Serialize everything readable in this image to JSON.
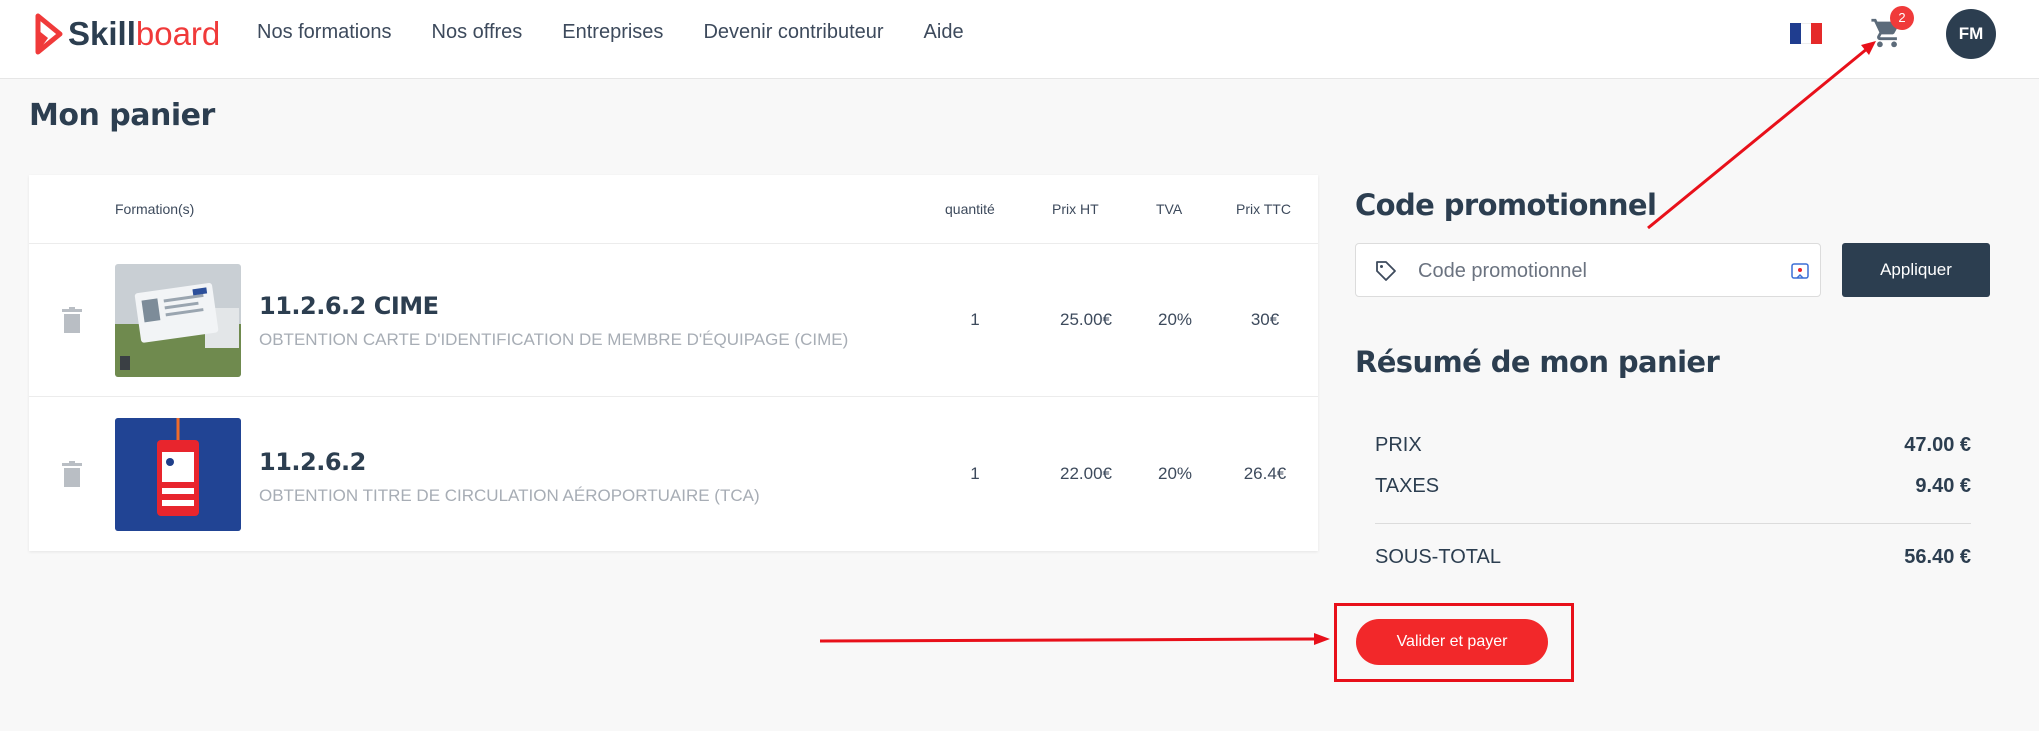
{
  "brand": {
    "part1": "Skill",
    "part2": "board"
  },
  "nav": [
    "Nos formations",
    "Nos offres",
    "Entreprises",
    "Devenir contributeur",
    "Aide"
  ],
  "cart_count": "2",
  "user_initials": "FM",
  "page_title": "Mon panier",
  "table": {
    "headers": {
      "formation": "Formation(s)",
      "qty": "quantité",
      "ht": "Prix HT",
      "tva": "TVA",
      "ttc": "Prix TTC"
    },
    "rows": [
      {
        "title": "11.2.6.2 CIME",
        "subtitle": "OBTENTION CARTE D'IDENTIFICATION DE MEMBRE D'ÉQUIPAGE (CIME)",
        "qty": "1",
        "ht": "25.00€",
        "tva": "20%",
        "ttc": "30€"
      },
      {
        "title": "11.2.6.2",
        "subtitle": "OBTENTION TITRE DE CIRCULATION AÉROPORTUAIRE (TCA)",
        "qty": "1",
        "ht": "22.00€",
        "tva": "20%",
        "ttc": "26.4€"
      }
    ]
  },
  "promo": {
    "title": "Code promotionnel",
    "placeholder": "Code promotionnel",
    "apply_label": "Appliquer"
  },
  "summary": {
    "title": "Résumé de mon panier",
    "prix_label": "PRIX",
    "prix_value": "47.00 €",
    "taxes_label": "TAXES",
    "taxes_value": "9.40 €",
    "subtotal_label": "SOUS-TOTAL",
    "subtotal_value": "56.40 €"
  },
  "pay_label": "Valider et payer",
  "colors": {
    "brand_red": "#f03a3a",
    "navy": "#2c3e50",
    "annotation_red": "#e8101a"
  },
  "icons": [
    "logo-mark-icon",
    "flag-fr-icon",
    "cart-icon",
    "trash-icon",
    "tag-icon",
    "extension-icon"
  ]
}
